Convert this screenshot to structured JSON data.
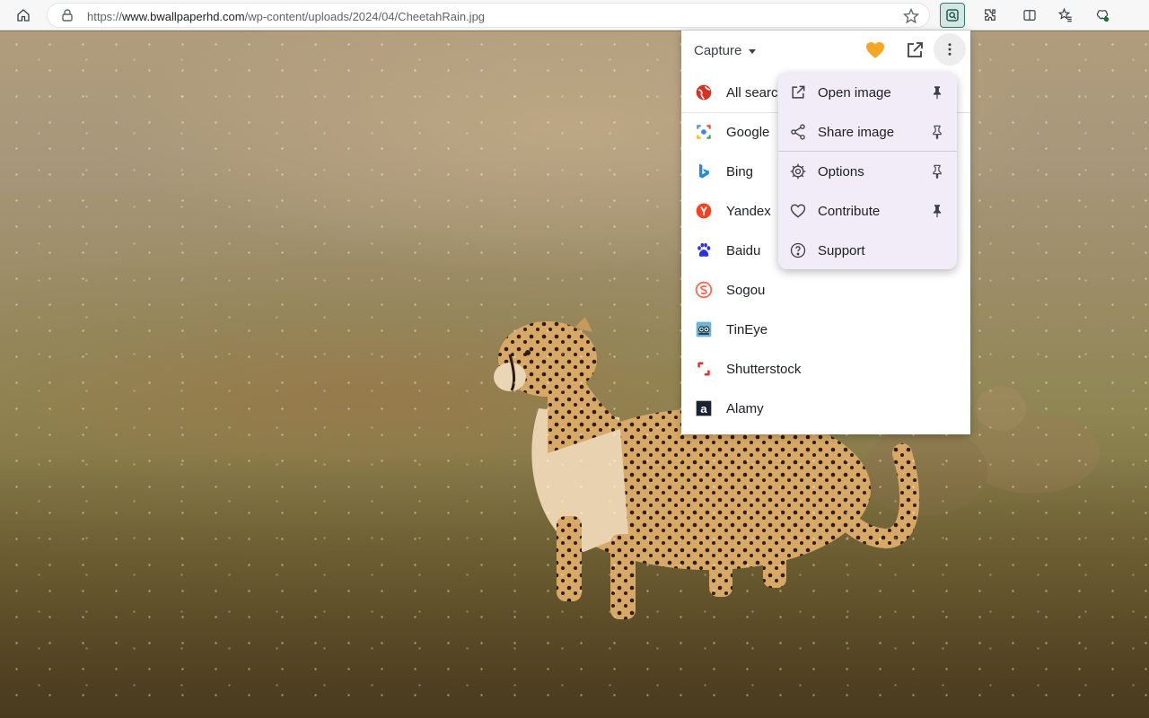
{
  "browser": {
    "url_scheme": "https://",
    "url_host": "www.bwallpaperhd.com",
    "url_path": "/wp-content/uploads/2024/04/CheetahRain.jpg"
  },
  "popup": {
    "capture_label": "Capture",
    "engines": [
      {
        "label": "All searc",
        "icon": "globe-icon"
      },
      {
        "label": "Google",
        "icon": "google-icon"
      },
      {
        "label": "Bing",
        "icon": "bing-icon"
      },
      {
        "label": "Yandex",
        "icon": "yandex-icon"
      },
      {
        "label": "Baidu",
        "icon": "baidu-icon"
      },
      {
        "label": "Sogou",
        "icon": "sogou-icon"
      },
      {
        "label": "TinEye",
        "icon": "tineye-icon"
      },
      {
        "label": "Shutterstock",
        "icon": "shutterstock-icon"
      },
      {
        "label": "Alamy",
        "icon": "alamy-icon"
      }
    ]
  },
  "menu": {
    "items": [
      {
        "label": "Open image",
        "icon": "open-external-icon",
        "pinned": true
      },
      {
        "label": "Share image",
        "icon": "share-icon",
        "pinned": false
      },
      {
        "label": "Options",
        "icon": "gear-icon",
        "pinned": false
      },
      {
        "label": "Contribute",
        "icon": "heart-outline-icon",
        "pinned": true
      },
      {
        "label": "Support",
        "icon": "help-circle-icon",
        "pinned": false
      }
    ]
  },
  "colors": {
    "heart": "#f5a623",
    "extension_accent": "#2f7d6d",
    "menu_bg": "#f1ecf8"
  }
}
